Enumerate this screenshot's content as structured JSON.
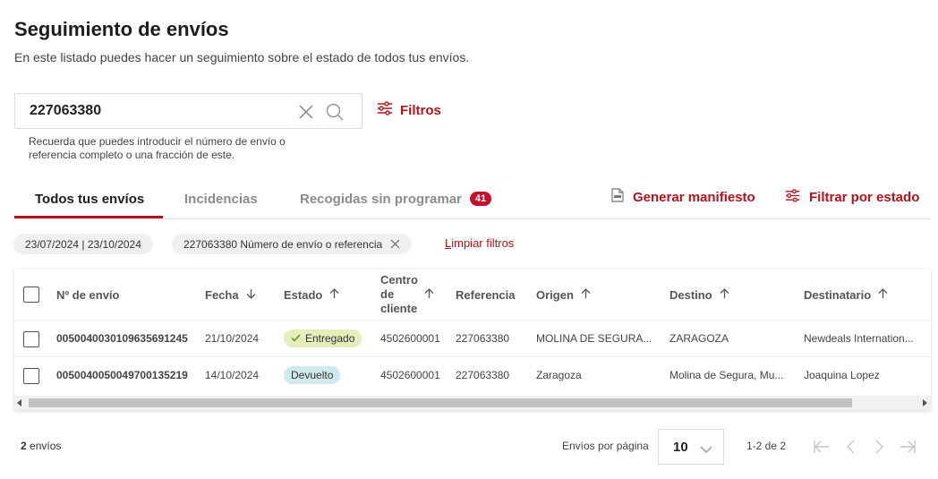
{
  "page": {
    "title": "Seguimiento de envíos",
    "subtitle": "En este listado puedes hacer un seguimiento sobre el estado de todos tus envíos."
  },
  "search": {
    "value": "227063380",
    "hint": "Recuerda que puedes introducir el número de envío o referencia completo o una fracción de este.",
    "clear_icon": "close-icon",
    "search_icon": "search-icon"
  },
  "filters_button": {
    "label": "Filtros",
    "icon": "sliders-icon"
  },
  "tabs": [
    {
      "label": "Todos tus envíos",
      "active": true
    },
    {
      "label": "Incidencias",
      "active": false
    },
    {
      "label": "Recogidas sin programar",
      "badge": "41",
      "active": false
    }
  ],
  "actions": {
    "manifest": {
      "label": "Generar manifiesto",
      "icon": "pdf-file-icon"
    },
    "status_filter": {
      "label": "Filtrar por estado",
      "icon": "sliders-icon"
    }
  },
  "active_filters": {
    "date_chip": "23/07/2024 | 23/10/2024",
    "search_chip": "227063380 Número de envío o referencia",
    "clear_label_first": "L",
    "clear_label_rest": "impiar filtros"
  },
  "table": {
    "columns": {
      "shipment_no": "Nº de envío",
      "date": "Fecha",
      "status": "Estado",
      "center": "Centro de cliente",
      "reference": "Referencia",
      "origin": "Origen",
      "destination": "Destino",
      "recipient": "Destinatario"
    },
    "rows": [
      {
        "shipment_no": "0050040030109635691245",
        "date": "21/10/2024",
        "status": "Entregado",
        "center": "4502600001",
        "reference": "227063380",
        "origin": "MOLINA DE SEGURA...",
        "destination": "ZARAGOZA",
        "recipient": "Newdeals Internation..."
      },
      {
        "shipment_no": "0050040050049700135219",
        "date": "14/10/2024",
        "status": "Devuelto",
        "center": "4502600001",
        "reference": "227063380",
        "origin": "Zaragoza",
        "destination": "Molina de Segura, Mu...",
        "recipient": "Joaquina Lopez"
      }
    ]
  },
  "footer": {
    "count_number": "2",
    "count_label": " envíos",
    "per_page_label": "Envíos por página",
    "per_page_value": "10",
    "range": "1-2 de 2"
  },
  "colors": {
    "brand_red": "#b5121b",
    "badge_red": "#c8102e",
    "status_delivered_bg": "#e5eebb",
    "status_returned_bg": "#cfe9ec"
  }
}
